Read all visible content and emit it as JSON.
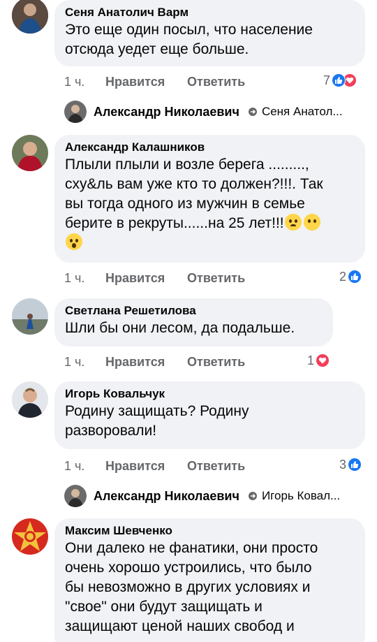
{
  "comments": [
    {
      "author": "Сеня Анатолич Варм",
      "lines": [
        "Это еще один посыл, что население",
        "отсюда уедет еще больше."
      ],
      "time": "1 ч.",
      "like": "Нравится",
      "reply": "Ответить",
      "reaction_count": "7",
      "reactions": [
        "like-icon",
        "love-icon"
      ]
    },
    {
      "author": "Александр Калашников",
      "lines": [
        "Плыли плыли и возле берега .........,",
        "сху&ль вам уже кто то должен?!!!. Так",
        "вы тогда одного из мужчин в семье",
        "берите в рекруты......на 25 лет!!!"
      ],
      "emojis": [
        "frown-emoji",
        "blank-face-emoji",
        "wow-emoji"
      ],
      "time": "1 ч.",
      "like": "Нравится",
      "reply": "Ответить",
      "reaction_count": "2",
      "reactions": [
        "like-icon"
      ]
    },
    {
      "author": "Светлана Решетилова",
      "lines": [
        "Шли бы они лесом, да подальше."
      ],
      "time": "1 ч.",
      "like": "Нравится",
      "reply": "Ответить",
      "reaction_count": "1",
      "reactions": [
        "love-icon"
      ]
    },
    {
      "author": "Игорь Ковальчук",
      "lines": [
        "Родину защищать? Родину",
        "разворовали!"
      ],
      "time": "1 ч.",
      "like": "Нравится",
      "reply": "Ответить",
      "reaction_count": "3",
      "reactions": [
        "like-icon"
      ]
    },
    {
      "author": "Максим Шевченко",
      "lines": [
        "Они далеко не фанатики, они просто",
        "очень хорошо устроились, что было",
        "бы невозможно в других условиях и",
        "\"свое\" они будут защищать и",
        "защищают ценой наших свобод и"
      ]
    }
  ],
  "replies": [
    {
      "author": "Александр Николаевич",
      "to": "Сеня Анатол..."
    },
    {
      "author": "Александр Николаевич",
      "to": "Игорь Ковал..."
    }
  ],
  "colors": {
    "bubble": "#f0f2f5",
    "like_blue": "#1877f2",
    "love_red": "#f33e58",
    "meta_gray": "#65676b"
  }
}
